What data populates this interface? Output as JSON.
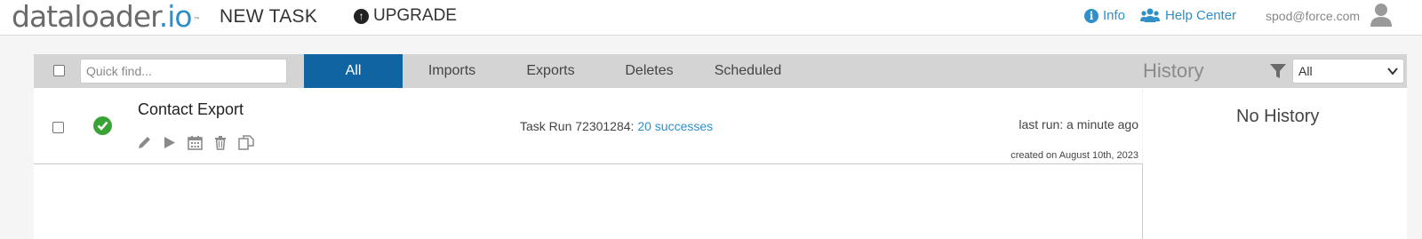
{
  "header": {
    "logo_data": "dataloader",
    "logo_io": ".io",
    "logo_tm": "™",
    "new_task": "NEW TASK",
    "upgrade": "UPGRADE",
    "info": "Info",
    "help_center": "Help Center",
    "user_email": "spod@force.com"
  },
  "filterbar": {
    "quickfind_placeholder": "Quick find...",
    "tabs": [
      {
        "label": "All",
        "active": true
      },
      {
        "label": "Imports",
        "active": false
      },
      {
        "label": "Exports",
        "active": false
      },
      {
        "label": "Deletes",
        "active": false
      },
      {
        "label": "Scheduled",
        "active": false
      }
    ],
    "history_label": "History",
    "history_filter_value": "All"
  },
  "tasks": [
    {
      "name": "Contact Export",
      "status": "success",
      "run_prefix": "Task Run 72301284: ",
      "run_link": "20 successes",
      "last_run": "last run: a minute ago",
      "created_on": "created on August 10th, 2023",
      "actions": [
        "edit-icon",
        "run-icon",
        "schedule-icon",
        "delete-icon",
        "copy-icon"
      ]
    }
  ],
  "history": {
    "empty_text": "No History"
  },
  "colors": {
    "accent": "#0f64a1",
    "link": "#2e8fc9",
    "success": "#3aa335"
  }
}
